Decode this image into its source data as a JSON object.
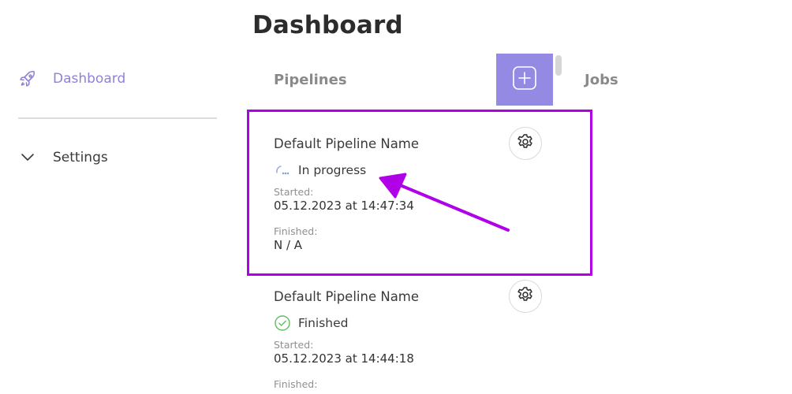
{
  "header": {
    "title": "Dashboard"
  },
  "sidebar": {
    "items": [
      {
        "label": "Dashboard",
        "icon": "rocket-icon",
        "active": true
      },
      {
        "label": "Settings",
        "icon": "chevron-down-icon",
        "active": false
      }
    ]
  },
  "main": {
    "pipelines_title": "Pipelines",
    "jobs_title": "Jobs",
    "add_icon": "plus-icon",
    "pipelines": [
      {
        "name": "Default Pipeline Name",
        "status": "In progress",
        "status_icon": "spinner-icon",
        "started_label": "Started:",
        "started_value": "05.12.2023 at 14:47:34",
        "finished_label": "Finished:",
        "finished_value": "N / A"
      },
      {
        "name": "Default Pipeline Name",
        "status": "Finished",
        "status_icon": "check-circle-icon",
        "started_label": "Started:",
        "started_value": "05.12.2023 at 14:44:18",
        "finished_label": "Finished:"
      }
    ]
  },
  "colors": {
    "accent": "#958ae3",
    "active_nav": "#8f82d6",
    "success": "#5cc25c",
    "annotation": "#b000e8"
  }
}
